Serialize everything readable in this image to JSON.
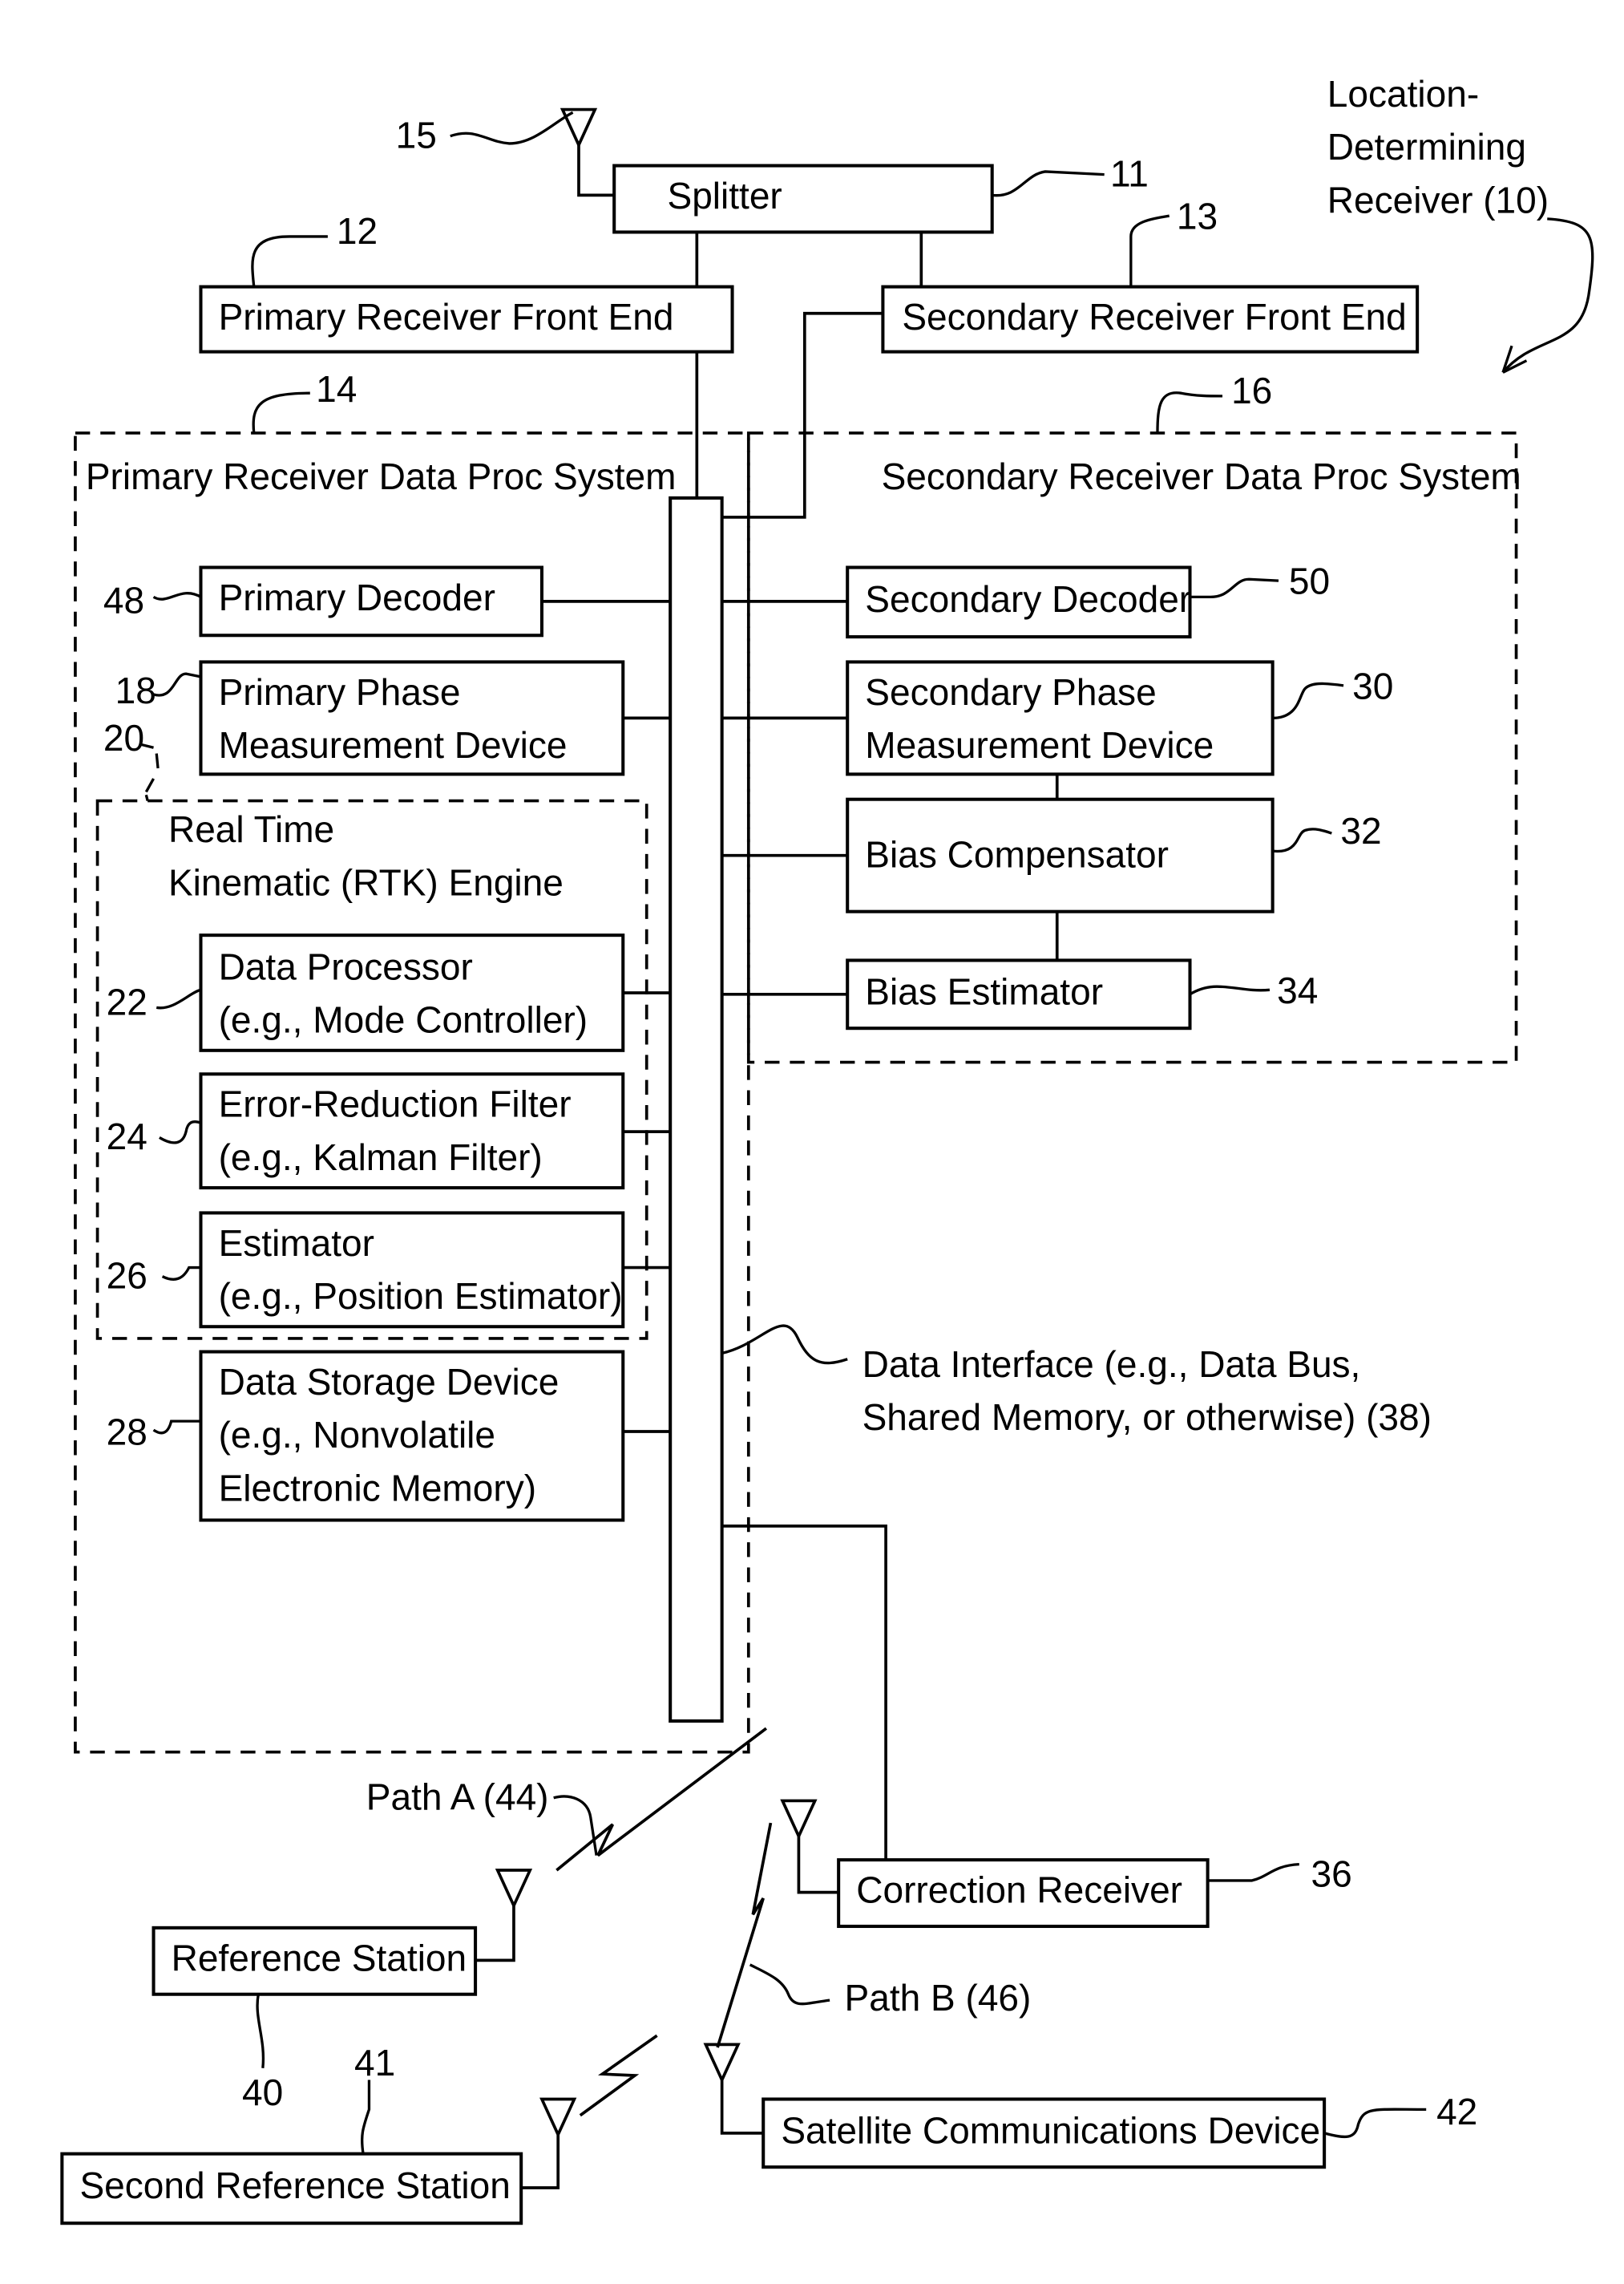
{
  "figure": {
    "title_lines": [
      "Location-",
      "Determining",
      "Receiver (10)"
    ],
    "blocks": {
      "splitter": {
        "lines": [
          "Splitter"
        ],
        "ref": "11"
      },
      "primary_front_end": {
        "lines": [
          "Primary Receiver Front End"
        ],
        "ref": "12"
      },
      "secondary_front_end": {
        "lines": [
          "Secondary Receiver Front End"
        ],
        "ref": "13"
      },
      "primary_decoder": {
        "lines": [
          "Primary Decoder"
        ],
        "ref": "48"
      },
      "primary_phase": {
        "lines": [
          "Primary Phase",
          "Measurement Device"
        ],
        "ref": "18"
      },
      "data_processor": {
        "lines": [
          "Data Processor",
          "(e.g., Mode Controller)"
        ],
        "ref": "22"
      },
      "error_filter": {
        "lines": [
          "Error-Reduction Filter",
          "(e.g., Kalman Filter)"
        ],
        "ref": "24"
      },
      "estimator": {
        "lines": [
          "Estimator",
          "(e.g., Position Estimator)"
        ],
        "ref": "26"
      },
      "data_storage": {
        "lines": [
          "Data Storage Device",
          "(e.g., Nonvolatile",
          "Electronic Memory)"
        ],
        "ref": "28"
      },
      "secondary_decoder": {
        "lines": [
          "Secondary Decoder"
        ],
        "ref": "50"
      },
      "secondary_phase": {
        "lines": [
          "Secondary Phase",
          "Measurement Device"
        ],
        "ref": "30"
      },
      "bias_compensator": {
        "lines": [
          "Bias Compensator"
        ],
        "ref": "32"
      },
      "bias_estimator": {
        "lines": [
          "Bias Estimator"
        ],
        "ref": "34"
      },
      "correction_receiver": {
        "lines": [
          "Correction Receiver"
        ],
        "ref": "36"
      },
      "reference_station": {
        "lines": [
          "Reference Station"
        ],
        "ref": "40"
      },
      "second_reference_station": {
        "lines": [
          "Second Reference Station"
        ],
        "ref": "41"
      },
      "satellite_comm": {
        "lines": [
          "Satellite Communications Device"
        ],
        "ref": "42"
      }
    },
    "groups": {
      "primary_system": {
        "label": "Primary Receiver Data Proc System",
        "ref": "14"
      },
      "secondary_system": {
        "label": "Secondary Receiver Data Proc System",
        "ref": "16"
      },
      "rtk_engine": {
        "lines": [
          "Real Time",
          "Kinematic (RTK) Engine"
        ],
        "ref": "20"
      }
    },
    "antenna_ref": "15",
    "data_interface_lines": [
      "Data Interface (e.g., Data Bus,",
      "Shared Memory, or otherwise) (38)"
    ],
    "path_a": "Path A (44)",
    "path_b": "Path B (46)"
  }
}
